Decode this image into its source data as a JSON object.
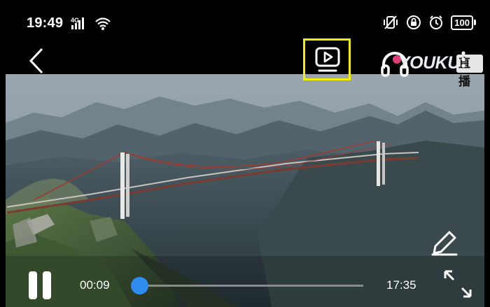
{
  "status_bar": {
    "time": "19:49",
    "network": "4G",
    "battery": "100"
  },
  "player": {
    "logo_text": "YOUKU",
    "logo_badge": "直播",
    "current_time": "00:09",
    "duration": "17:35",
    "progress_fraction": 0.01
  },
  "colors": {
    "highlight": "#f2f000",
    "seek_accent": "#2f8cf0"
  },
  "icons": [
    "signal-icon",
    "wifi-icon",
    "vibrate-icon",
    "lock-rotation-icon",
    "alarm-icon",
    "battery-icon",
    "back-icon",
    "cast-icon",
    "headphones-icon",
    "more-icon",
    "edit-icon",
    "pause-icon",
    "fullscreen-icon"
  ]
}
